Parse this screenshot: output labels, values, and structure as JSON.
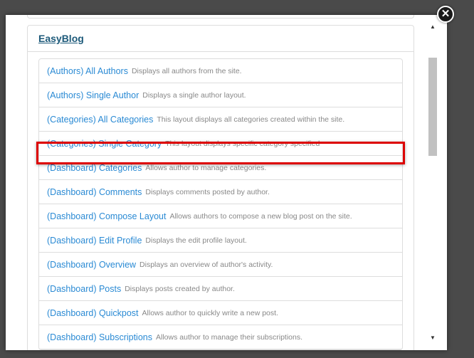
{
  "modal": {
    "close_symbol": "✕",
    "panel_title": "EasyBlog",
    "items": [
      {
        "title": "(Authors) All Authors",
        "desc": "Displays all authors from the site."
      },
      {
        "title": "(Authors) Single Author",
        "desc": "Displays a single author layout."
      },
      {
        "title": "(Categories) All Categories",
        "desc": "This layout displays all categories created within the site."
      },
      {
        "title": "(Categories) Single Category",
        "desc": "This layout displays specific category specified"
      },
      {
        "title": "(Dashboard) Categories",
        "desc": "Allows author to manage categories."
      },
      {
        "title": "(Dashboard) Comments",
        "desc": "Displays comments posted by author."
      },
      {
        "title": "(Dashboard) Compose Layout",
        "desc": "Allows authors to compose a new blog post on the site."
      },
      {
        "title": "(Dashboard) Edit Profile",
        "desc": "Displays the edit profile layout."
      },
      {
        "title": "(Dashboard) Overview",
        "desc": "Displays an overview of author's activity."
      },
      {
        "title": "(Dashboard) Posts",
        "desc": "Displays posts created by author."
      },
      {
        "title": "(Dashboard) Quickpost",
        "desc": "Allows author to quickly write a new post."
      },
      {
        "title": "(Dashboard) Subscriptions",
        "desc": "Allows author to manage their subscriptions."
      }
    ]
  },
  "scrollbar": {
    "up_symbol": "▲",
    "down_symbol": "▼"
  },
  "colors": {
    "highlight": "#dd0000",
    "link": "#2a8ad4",
    "title": "#1d5a7a"
  }
}
